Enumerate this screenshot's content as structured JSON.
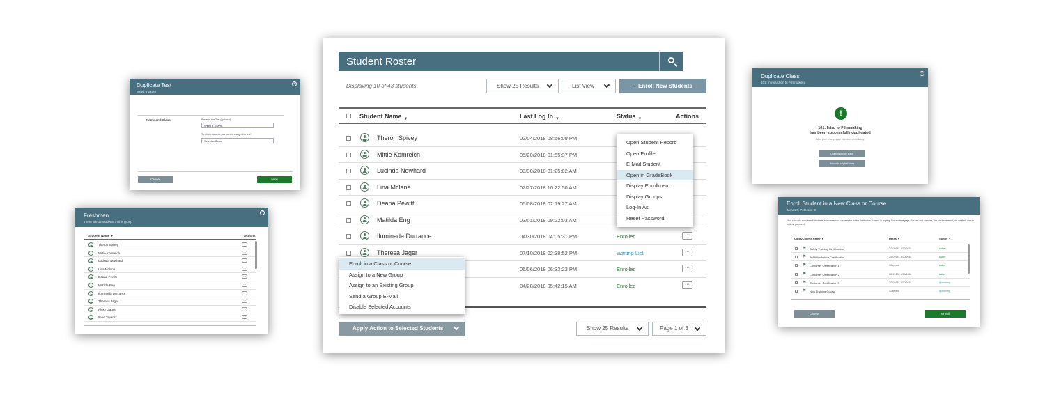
{
  "roster": {
    "title": "Student Roster",
    "displaying": "Displaying 10 of 43 students",
    "show_results": "Show 25 Results",
    "list_view": "List View",
    "enroll_btn": "+ Enroll New Students",
    "headers": {
      "name": "Student Name",
      "last_login": "Last Log In",
      "status": "Status",
      "actions": "Actions"
    },
    "rows": [
      {
        "name": "Theron Spivey",
        "date": "02/04/2018 08:56:09 PM",
        "status": ""
      },
      {
        "name": "Mittie Komreich",
        "date": "05/20/2018 01:55:37 PM",
        "status": ""
      },
      {
        "name": "Lucinda Newhard",
        "date": "03/30/2018 01:25:02 AM",
        "status": ""
      },
      {
        "name": "Lina Mclane",
        "date": "02/27/2018 10:22:50 AM",
        "status": ""
      },
      {
        "name": "Deana Pewitt",
        "date": "05/08/2018 02:19:27 AM",
        "status": ""
      },
      {
        "name": "Matilda Eng",
        "date": "03/01/2018 09:22:03 AM",
        "status": ""
      },
      {
        "name": "Iluminada Durrance",
        "date": "04/30/2018 04:05:31 PM",
        "status": "Enrolled"
      },
      {
        "name": "Theresa Jager",
        "date": "07/10/2018 02:38:52 PM",
        "status": "Waiting List"
      },
      {
        "name": "",
        "date": "06/06/2018 06:32:23 PM",
        "status": "Enrolled"
      },
      {
        "name": "",
        "date": "04/28/2018 05:42:15 AM",
        "status": "Enrolled"
      }
    ],
    "row_menu": [
      "Open Student Record",
      "Open Profile",
      "E-Mail Student",
      "Open in GradeBook",
      "Display Enrollment",
      "Display Groups",
      "Log-In As",
      "Reset Password"
    ],
    "bulk_menu": [
      "Enroll in a Class or Course",
      "Assign to a New Group",
      "Assign to an Existing Group",
      "Send a Group E-Mail",
      "Disable Selected Accounts"
    ],
    "apply_action": "Apply Action to Selected Students",
    "show_results_bottom": "Show 25 Results",
    "page_of": "Page 1 of 3"
  },
  "duplicate_test": {
    "title": "Duplicate Test",
    "subtitle": "Week 4 Exam",
    "section_label": "Name and Class",
    "field1_label": "Rename the Test (optional)",
    "field1_value": "Week 4 Exam",
    "field2_label": "To which class do you want to assign this test?",
    "field2_value": "Select a Class",
    "cancel": "Cancel",
    "next": "Next"
  },
  "freshmen": {
    "title": "Freshmen",
    "subtitle": "There are 12 students in this group",
    "col_name": "Student Name",
    "col_actions": "Actions",
    "students": [
      "Theron Spivey",
      "Mittie Komreich",
      "Lucinda Newhard",
      "Lina Mclane",
      "Deana Pewitt",
      "Matilda Eng",
      "Iluminada Durrance",
      "Theresa Jager",
      "Ricky Gagne",
      "Ilene Tavarez"
    ]
  },
  "duplicate_class": {
    "title": "Duplicate Class",
    "subtitle": "101: Introduction to Filmmaking",
    "msg_line1": "101: Intro to Filmmaking",
    "msg_line2": "has been successfully duplicated",
    "msg_small": "All of your changes are effective immediately",
    "btn1": "Open duplicate class",
    "btn2": "Return to original class"
  },
  "enroll": {
    "title": "Enroll Student in a New Class or Course",
    "subtitle": "James P. Peterson III",
    "intro": "You can only auto-enroll students into classes or courses for which 'Institution Names' is paying. For student-pays classes and courses, the students must join on their own to submit payment.",
    "headers": {
      "name": "Class/Course Name",
      "dates": "Dates",
      "status": "Status"
    },
    "rows": [
      {
        "name": "Safety Training Certification",
        "dates": "2/1/2018 - 4/20/2018",
        "status": "Active"
      },
      {
        "name": "2018 Workshop Certification",
        "dates": "2/1/2018 - 4/20/2018",
        "status": "Active"
      },
      {
        "name": "Customer Certification 1",
        "dates": "12 weeks",
        "status": "Active"
      },
      {
        "name": "Customer Certification 2",
        "dates": "2/1/2018 - 4/20/2018",
        "status": "Active"
      },
      {
        "name": "Customer Certification 3",
        "dates": "2/1/2018 - 4/20/2018",
        "status": "Upcoming"
      },
      {
        "name": "New Training Course",
        "dates": "12 weeks",
        "status": "Upcoming"
      }
    ],
    "cancel": "Cancel",
    "enroll": "Enroll"
  },
  "colors": {
    "header": "#476f80",
    "green": "#1c7a2d",
    "button_grey": "#7c8f99",
    "menu_highlight": "#d9eaf2"
  }
}
